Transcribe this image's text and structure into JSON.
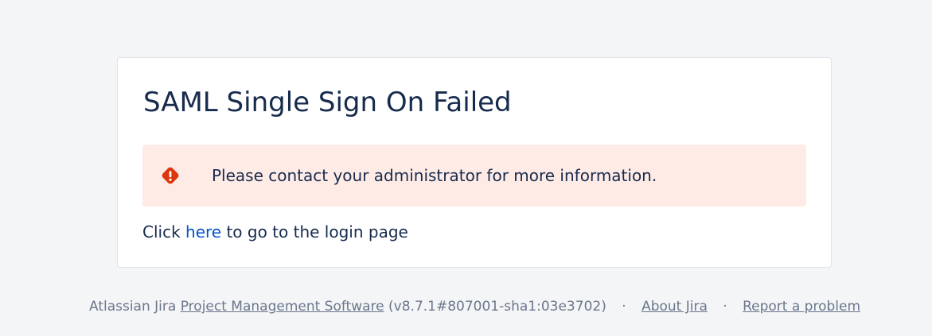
{
  "page": {
    "title": "SAML Single Sign On Failed"
  },
  "error": {
    "icon": "error-icon",
    "message": "Please contact your administrator for more information."
  },
  "login": {
    "prefix": "Click",
    "link_label": "here",
    "suffix": "to go to the login page"
  },
  "footer": {
    "brand_prefix": "Atlassian Jira",
    "product_link": "Project Management Software",
    "version": "(v8.7.1#807001-sha1:03e3702)",
    "separator": "·",
    "about_link": "About Jira",
    "report_link": "Report a problem"
  },
  "colors": {
    "background": "#f4f5f7",
    "card": "#ffffff",
    "error_panel": "#ffebe6",
    "error_icon": "#de350b",
    "link": "#0052cc",
    "text": "#172b4d",
    "footer_text": "#6b778c"
  }
}
